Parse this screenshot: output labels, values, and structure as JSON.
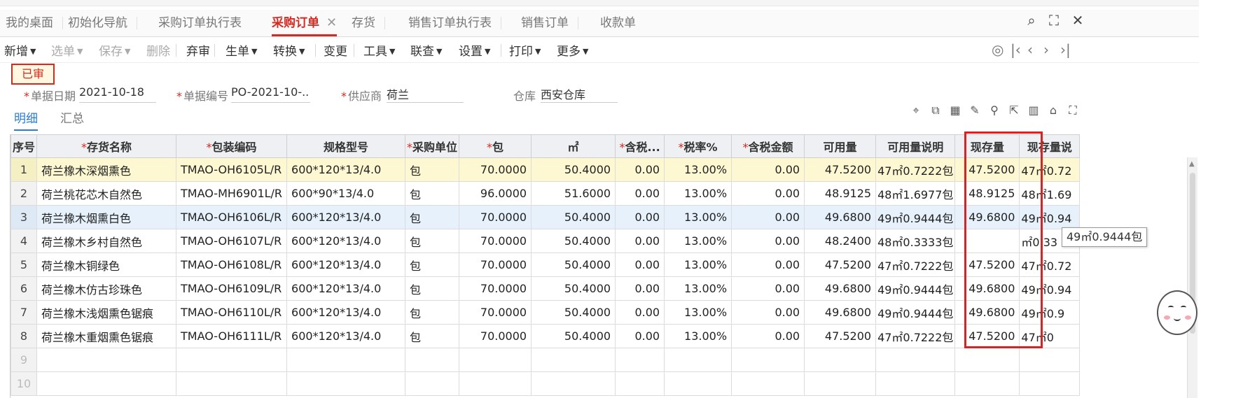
{
  "tabs": [
    {
      "label": "我的桌面",
      "active": false
    },
    {
      "label": "初始化导航",
      "active": false
    },
    {
      "label": "采购订单执行表",
      "active": false
    },
    {
      "label": "采购订单",
      "active": true
    },
    {
      "label": "存货",
      "active": false
    },
    {
      "label": "销售订单执行表",
      "active": false
    },
    {
      "label": "销售订单",
      "active": false
    },
    {
      "label": "收款单",
      "active": false
    }
  ],
  "window_icons": [
    "search-icon",
    "maximize-icon",
    "close-icon"
  ],
  "toolbar": {
    "buttons": [
      {
        "label": "新增",
        "dropdown": true,
        "enabled": true
      },
      {
        "label": "选单",
        "dropdown": true,
        "enabled": false
      },
      {
        "label": "保存",
        "dropdown": true,
        "enabled": false
      },
      {
        "label": "删除",
        "dropdown": false,
        "enabled": false
      },
      {
        "label": "弃审",
        "dropdown": false,
        "enabled": true
      },
      {
        "label": "生单",
        "dropdown": true,
        "enabled": true
      },
      {
        "label": "转换",
        "dropdown": true,
        "enabled": true
      },
      {
        "label": "变更",
        "dropdown": false,
        "enabled": true
      },
      {
        "label": "工具",
        "dropdown": true,
        "enabled": true
      },
      {
        "label": "联查",
        "dropdown": true,
        "enabled": true
      },
      {
        "label": "设置",
        "dropdown": true,
        "enabled": true
      },
      {
        "label": "打印",
        "dropdown": true,
        "enabled": true
      },
      {
        "label": "更多",
        "dropdown": true,
        "enabled": true
      }
    ],
    "nav_icons": [
      "locate-icon",
      "first-page-icon",
      "prev-page-icon",
      "next-page-icon",
      "last-page-icon"
    ]
  },
  "status_badge": "已审",
  "form": {
    "date": {
      "label": "单据日期",
      "value": "2021-10-18",
      "required": true
    },
    "doc_no": {
      "label": "单据编号",
      "value": "PO-2021-10-...",
      "required": true
    },
    "supplier": {
      "label": "供应商",
      "value": "荷兰",
      "required": true
    },
    "warehouse": {
      "label": "仓库",
      "value": "西安仓库",
      "required": false
    }
  },
  "subtabs": [
    {
      "label": "明细",
      "active": true
    },
    {
      "label": "汇总",
      "active": false
    }
  ],
  "grid_tool_icons": [
    "location-icon",
    "copy-rows-icon",
    "batch-icon",
    "edit-icon",
    "filter-icon",
    "export-icon",
    "columns-icon",
    "lock-icon",
    "fullscreen-icon"
  ],
  "table": {
    "columns": [
      {
        "label": "序号",
        "required": false
      },
      {
        "label": "存货名称",
        "required": true
      },
      {
        "label": "包装编码",
        "required": true
      },
      {
        "label": "规格型号",
        "required": false
      },
      {
        "label": "采购单位",
        "required": true
      },
      {
        "label": "包",
        "required": true
      },
      {
        "label": "㎡",
        "required": false
      },
      {
        "label": "含税...",
        "required": true
      },
      {
        "label": "税率%",
        "required": true
      },
      {
        "label": "含税金额",
        "required": true
      },
      {
        "label": "可用量",
        "required": false
      },
      {
        "label": "可用量说明",
        "required": false
      },
      {
        "label": "现存量",
        "required": false
      },
      {
        "label": "现存量说",
        "required": false
      }
    ],
    "rows": [
      {
        "idx": "1",
        "name": "荷兰橡木深烟熏色",
        "code": "TMAO-OH6105L/R",
        "spec": "600*120*13/4.0",
        "unit": "包",
        "pkg": "70.0000",
        "sqm": "50.4000",
        "price": "0.00",
        "tax": "13.00%",
        "amount": "0.00",
        "avail": "47.5200",
        "avail_note": "47㎡0.7222包",
        "stock": "47.5200",
        "stock_note": "47㎡0.72"
      },
      {
        "idx": "2",
        "name": "荷兰桃花芯木自然色",
        "code": "TMAO-MH6901L/R",
        "spec": "600*90*13/4.0",
        "unit": "包",
        "pkg": "96.0000",
        "sqm": "51.6000",
        "price": "0.00",
        "tax": "13.00%",
        "amount": "0.00",
        "avail": "48.9125",
        "avail_note": "48㎡1.6977包",
        "stock": "48.9125",
        "stock_note": "48㎡1.69"
      },
      {
        "idx": "3",
        "name": "荷兰橡木烟熏白色",
        "code": "TMAO-OH6106L/R",
        "spec": "600*120*13/4.0",
        "unit": "包",
        "pkg": "70.0000",
        "sqm": "50.4000",
        "price": "0.00",
        "tax": "13.00%",
        "amount": "0.00",
        "avail": "49.6800",
        "avail_note": "49㎡0.9444包",
        "stock": "49.6800",
        "stock_note": "49㎡0.94"
      },
      {
        "idx": "4",
        "name": "荷兰橡木乡村自然色",
        "code": "TMAO-OH6107L/R",
        "spec": "600*120*13/4.0",
        "unit": "包",
        "pkg": "70.0000",
        "sqm": "50.4000",
        "price": "0.00",
        "tax": "13.00%",
        "amount": "0.00",
        "avail": "48.2400",
        "avail_note": "48㎡0.3333包",
        "stock": "",
        "stock_note": "㎡0.33"
      },
      {
        "idx": "5",
        "name": "荷兰橡木铜绿色",
        "code": "TMAO-OH6108L/R",
        "spec": "600*120*13/4.0",
        "unit": "包",
        "pkg": "70.0000",
        "sqm": "50.4000",
        "price": "0.00",
        "tax": "13.00%",
        "amount": "0.00",
        "avail": "47.5200",
        "avail_note": "47㎡0.7222包",
        "stock": "47.5200",
        "stock_note": "47㎡0.72"
      },
      {
        "idx": "6",
        "name": "荷兰橡木仿古珍珠色",
        "code": "TMAO-OH6109L/R",
        "spec": "600*120*13/4.0",
        "unit": "包",
        "pkg": "70.0000",
        "sqm": "50.4000",
        "price": "0.00",
        "tax": "13.00%",
        "amount": "0.00",
        "avail": "49.6800",
        "avail_note": "49㎡0.9444包",
        "stock": "49.6800",
        "stock_note": "49㎡0.94"
      },
      {
        "idx": "7",
        "name": "荷兰橡木浅烟熏色锯痕",
        "code": "TMAO-OH6110L/R",
        "spec": "600*120*13/4.0",
        "unit": "包",
        "pkg": "70.0000",
        "sqm": "50.4000",
        "price": "0.00",
        "tax": "13.00%",
        "amount": "0.00",
        "avail": "49.6800",
        "avail_note": "49㎡0.9444包",
        "stock": "49.6800",
        "stock_note": "49㎡0.9"
      },
      {
        "idx": "8",
        "name": "荷兰橡木重烟熏色锯痕",
        "code": "TMAO-OH6111L/R",
        "spec": "600*120*13/4.0",
        "unit": "包",
        "pkg": "70.0000",
        "sqm": "50.4000",
        "price": "0.00",
        "tax": "13.00%",
        "amount": "0.00",
        "avail": "47.5200",
        "avail_note": "47㎡0.7222包",
        "stock": "47.5200",
        "stock_note": "47㎡0"
      }
    ],
    "empty_rows": [
      "9",
      "10"
    ]
  },
  "tooltip": "49㎡0.9444包",
  "colors": {
    "accent": "#d9281f",
    "link_blue": "#2b7cd3",
    "highlight_box": "#e02020",
    "selected_row": "#fdf8d2",
    "hover_row": "#e7f1fb"
  }
}
